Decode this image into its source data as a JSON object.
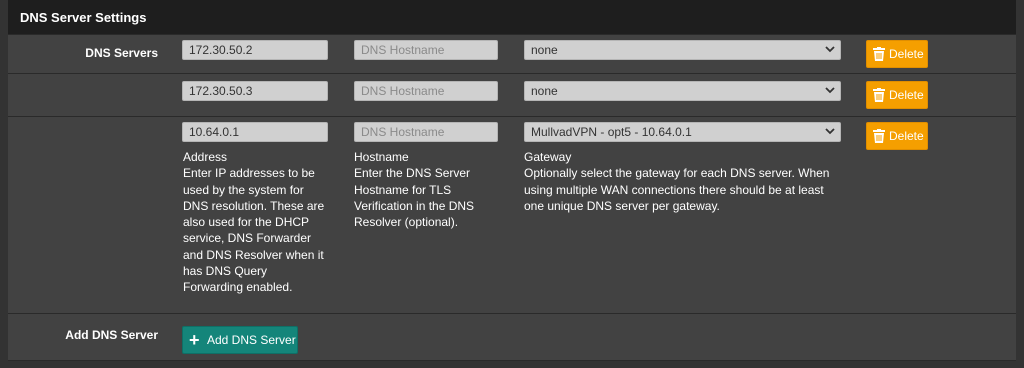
{
  "panel": {
    "title": "DNS Server Settings"
  },
  "dns_servers": {
    "label": "DNS Servers",
    "rows": [
      {
        "address": "172.30.50.2",
        "hostname_placeholder": "DNS Hostname",
        "gateway": "none",
        "delete_label": "Delete"
      },
      {
        "address": "172.30.50.3",
        "hostname_placeholder": "DNS Hostname",
        "gateway": "none",
        "delete_label": "Delete"
      },
      {
        "address": "10.64.0.1",
        "hostname_placeholder": "DNS Hostname",
        "gateway": "MullvadVPN - opt5 - 10.64.0.1",
        "delete_label": "Delete"
      }
    ],
    "help": {
      "address_title": "Address",
      "address_lines": [
        "Enter IP addresses to be",
        "used by the system for",
        "DNS resolution. These are",
        "also used for the DHCP",
        "service, DNS Forwarder",
        "and DNS Resolver when it",
        "has DNS Query",
        "Forwarding enabled."
      ],
      "hostname_title": "Hostname",
      "hostname_lines": [
        "Enter the DNS Server",
        "Hostname for TLS",
        "Verification in the DNS",
        "Resolver (optional)."
      ],
      "gateway_title": "Gateway",
      "gateway_lines": [
        "Optionally select the gateway for each DNS server. When",
        "using multiple WAN connections there should be at least",
        "one unique DNS server per gateway."
      ]
    }
  },
  "add_dns_server": {
    "label": "Add DNS Server",
    "button_label": "Add DNS Server"
  },
  "colors": {
    "delete_button": "#f59f00",
    "add_button": "#14857a",
    "panel_header": "#1e1e1e",
    "row_bg": "#424242"
  },
  "icons": {
    "delete": "trash-icon",
    "add": "plus-icon",
    "select": "chevron-down-icon"
  }
}
